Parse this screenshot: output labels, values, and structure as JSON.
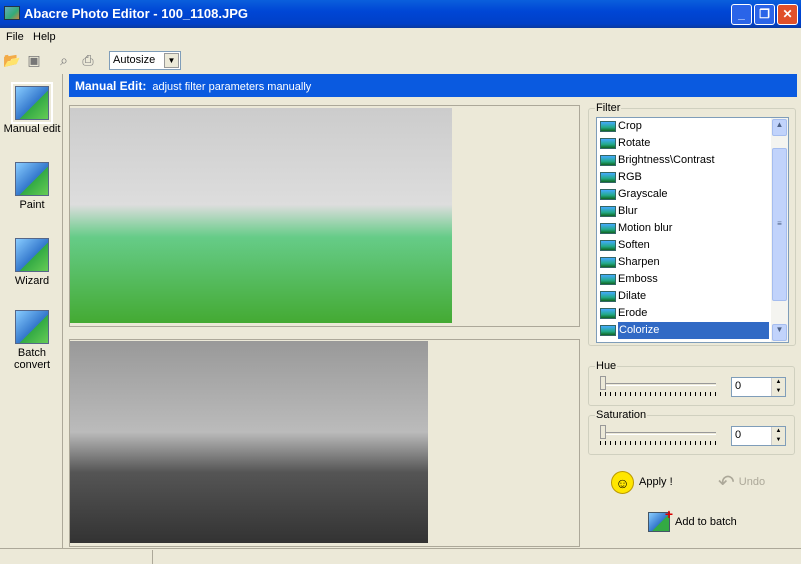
{
  "window": {
    "title": "Abacre Photo Editor - 100_1108.JPG",
    "minimize": "_",
    "maximize": "❐",
    "close": "✕"
  },
  "menu": [
    "File",
    "Help"
  ],
  "toolbar": {
    "zoom_select": "Autosize",
    "icons": [
      "open-icon",
      "save-icon",
      "preview-icon",
      "print-icon"
    ]
  },
  "sidebar": [
    {
      "label": "Manual edit",
      "active": true
    },
    {
      "label": "Paint"
    },
    {
      "label": "Wizard"
    },
    {
      "label": "Batch convert"
    }
  ],
  "header": {
    "title": "Manual Edit:",
    "subtitle": "adjust filter parameters manually"
  },
  "filter": {
    "label": "Filter",
    "items": [
      "Crop",
      "Rotate",
      "Brightness\\Contrast",
      "RGB",
      "Grayscale",
      "Blur",
      "Motion blur",
      "Soften",
      "Sharpen",
      "Emboss",
      "Dilate",
      "Erode",
      "Colorize"
    ],
    "selected": "Colorize"
  },
  "hue": {
    "label": "Hue",
    "value": "0"
  },
  "saturation": {
    "label": "Saturation",
    "value": "0"
  },
  "actions": {
    "apply": "Apply !",
    "undo": "Undo",
    "add_to_batch": "Add to batch"
  },
  "colors": {
    "accent": "#0a5ae0",
    "selection": "#316ac5"
  }
}
